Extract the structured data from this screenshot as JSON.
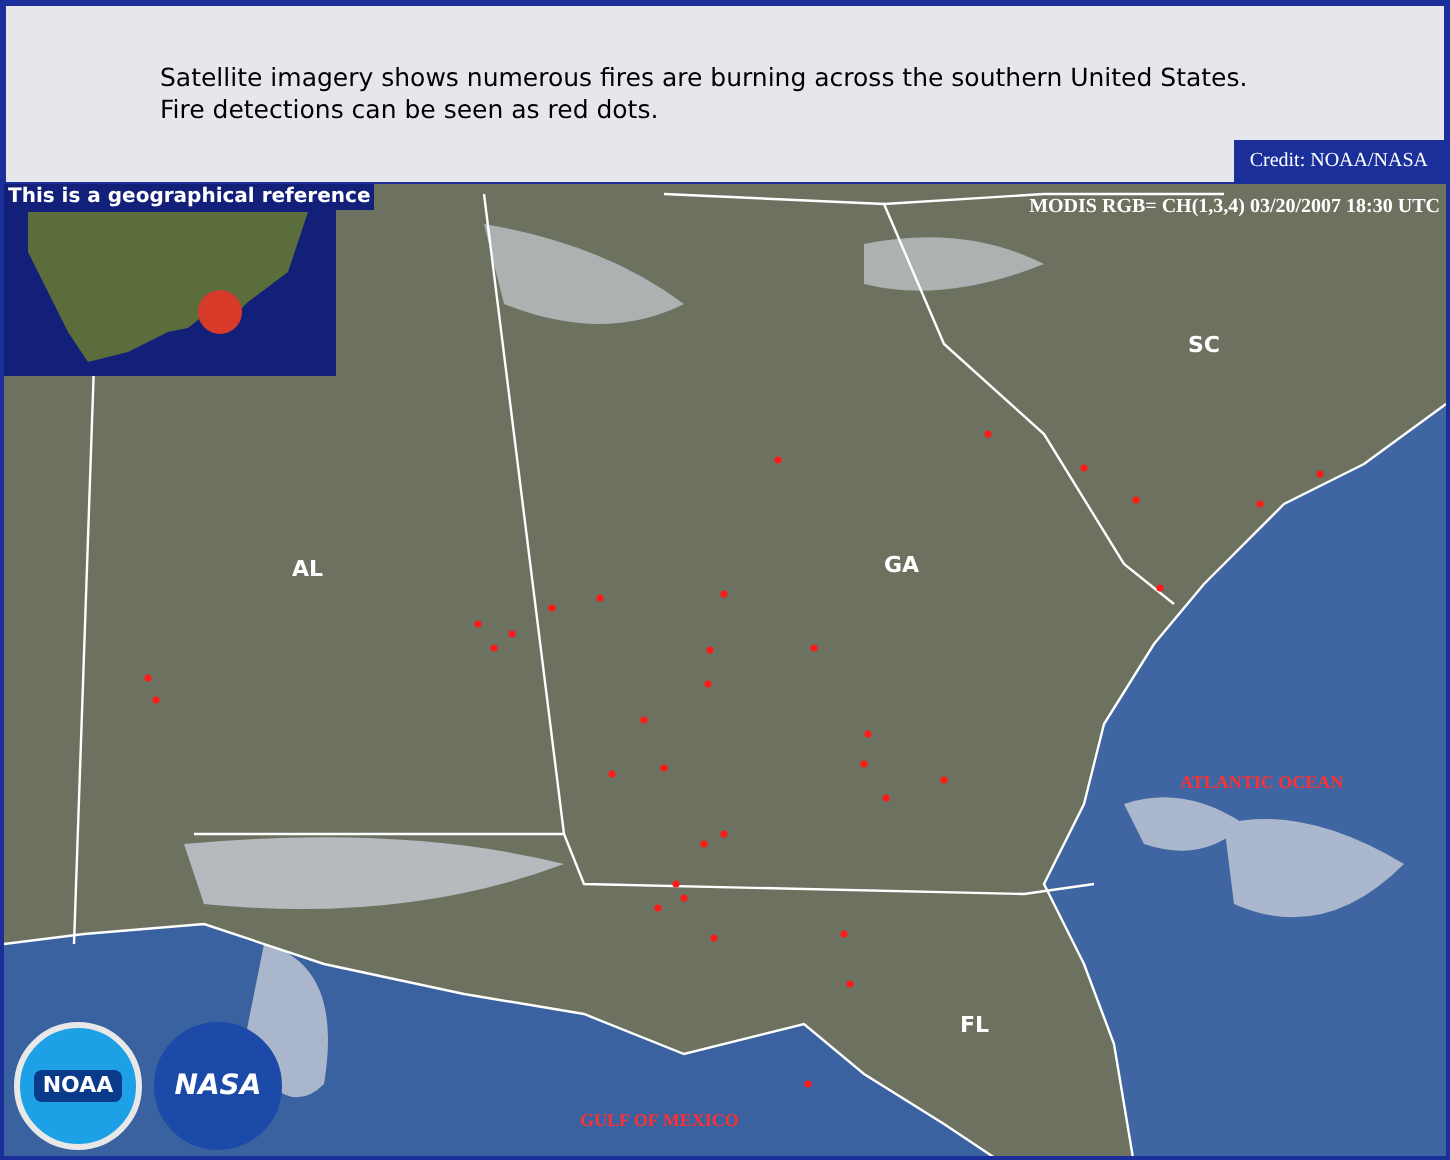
{
  "header": {
    "lines": [
      "Satellite imagery shows numerous fires are burning across the southern United States.",
      "Fire detections can be seen as red dots."
    ],
    "credit": "Credit: NOAA/NASA"
  },
  "inset": {
    "caption": "This is a geographical reference"
  },
  "map": {
    "timestamp": "MODIS RGB= CH(1,3,4) 03/20/2007 18:30 UTC",
    "state_labels": [
      "SC",
      "AL",
      "GA",
      "FL"
    ],
    "water_labels": [
      "ATLANTIC OCEAN",
      "GULF OF MEXICO"
    ]
  },
  "logos": [
    "NOAA",
    "NASA"
  ]
}
